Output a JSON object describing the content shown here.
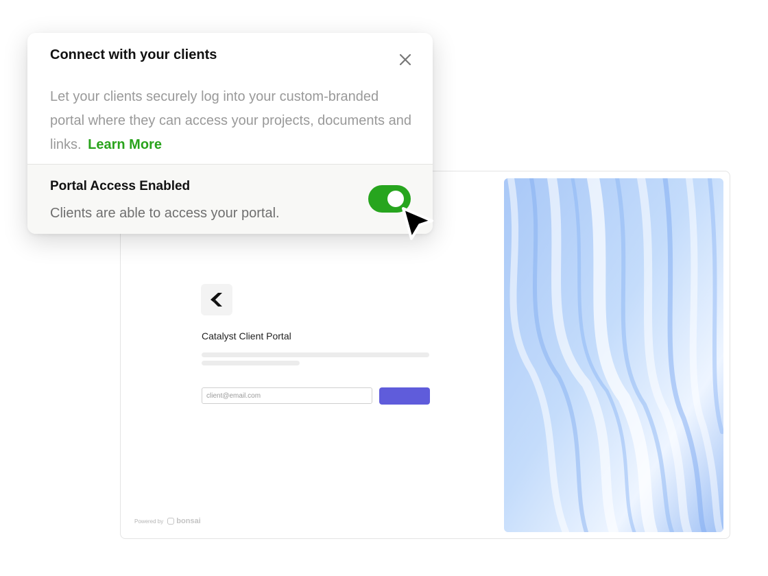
{
  "popover": {
    "title": "Connect with your clients",
    "description": "Let your clients securely log into your custom-branded portal where they can access your projects, documents and links.",
    "learn_more_label": "Learn More",
    "close_icon": "close-icon",
    "access": {
      "title": "Portal Access Enabled",
      "subtitle": "Clients are able to access your portal.",
      "enabled": true
    }
  },
  "portal": {
    "title": "Catalyst Client Portal",
    "email_placeholder": "client@email.com",
    "submit_color": "#5f5cdb",
    "powered_by_label": "Powered by",
    "brand_name": "bonsai"
  },
  "colors": {
    "accent_green": "#27a51e",
    "learn_more_green": "#29a31c"
  }
}
